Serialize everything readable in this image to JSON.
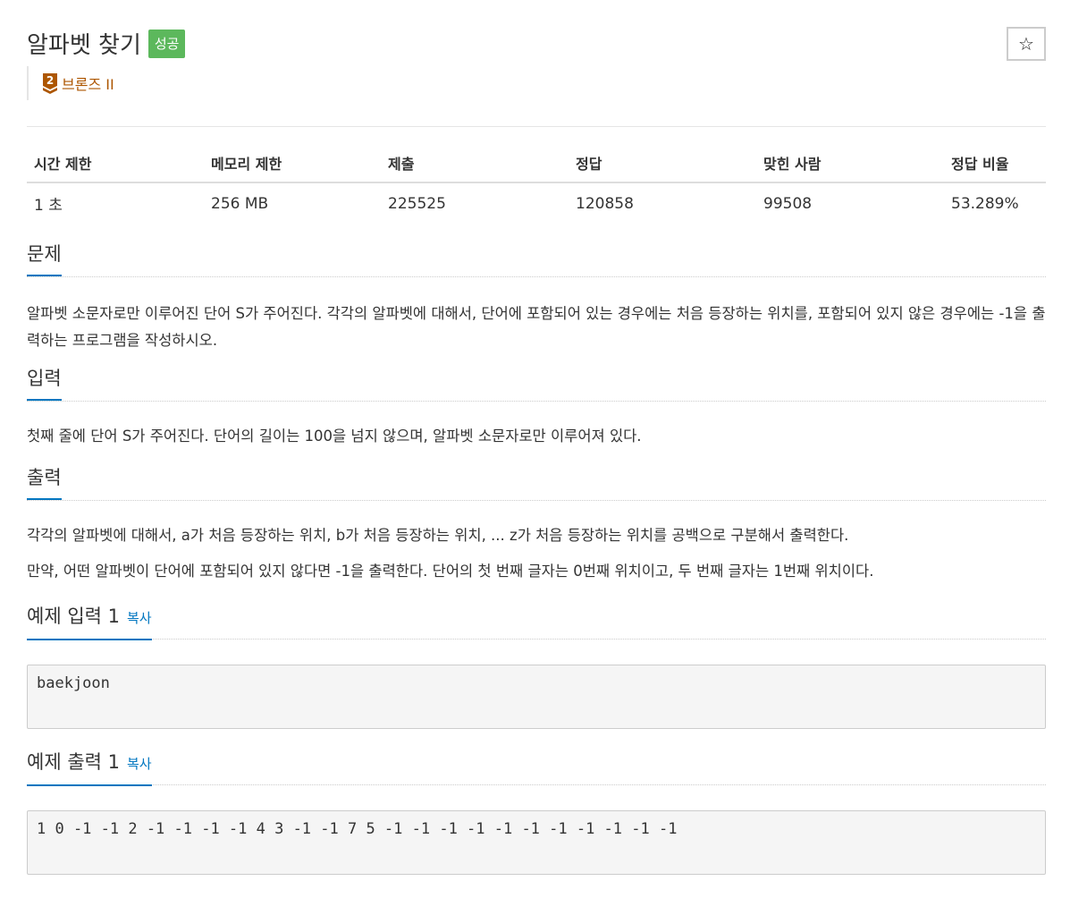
{
  "problem": {
    "title": "알파벳 찾기",
    "status_badge": "성공",
    "star_icon": "☆",
    "tier": {
      "number": "2",
      "label": "브론즈 II",
      "color": "#ad5600"
    }
  },
  "stats": {
    "headers": [
      "시간 제한",
      "메모리 제한",
      "제출",
      "정답",
      "맞힌 사람",
      "정답 비율"
    ],
    "values": [
      "1 초",
      "256 MB",
      "225525",
      "120858",
      "99508",
      "53.289%"
    ]
  },
  "sections": {
    "description": {
      "title": "문제",
      "text": "알파벳 소문자로만 이루어진 단어 S가 주어진다. 각각의 알파벳에 대해서, 단어에 포함되어 있는 경우에는 처음 등장하는 위치를, 포함되어 있지 않은 경우에는 -1을 출력하는 프로그램을 작성하시오."
    },
    "input": {
      "title": "입력",
      "text": "첫째 줄에 단어 S가 주어진다. 단어의 길이는 100을 넘지 않으며, 알파벳 소문자로만 이루어져 있다."
    },
    "output": {
      "title": "출력",
      "text1": "각각의 알파벳에 대해서, a가 처음 등장하는 위치, b가 처음 등장하는 위치, ... z가 처음 등장하는 위치를 공백으로 구분해서 출력한다.",
      "text2": "만약, 어떤 알파벳이 단어에 포함되어 있지 않다면 -1을 출력한다. 단어의 첫 번째 글자는 0번째 위치이고, 두 번째 글자는 1번째 위치이다."
    },
    "sample_input": {
      "title": "예제 입력 1",
      "copy_label": "복사",
      "content": "baekjoon"
    },
    "sample_output": {
      "title": "예제 출력 1",
      "copy_label": "복사",
      "content": "1 0 -1 -1 2 -1 -1 -1 -1 4 3 -1 -1 7 5 -1 -1 -1 -1 -1 -1 -1 -1 -1 -1 -1"
    }
  }
}
